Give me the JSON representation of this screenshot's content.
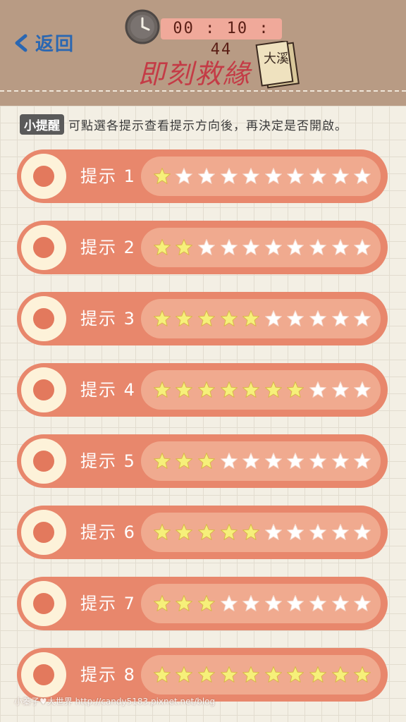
{
  "header": {
    "back_label": "返回",
    "timer": "00 : 10 : 44",
    "logo_text": "即刻救緣",
    "ticket_text": "大溪"
  },
  "reminder": {
    "tag": "小提醒",
    "text": "可點選各提示查看提示方向後，再決定是否開啟。"
  },
  "hints": [
    {
      "label": "提示 1",
      "stars": 1
    },
    {
      "label": "提示 2",
      "stars": 2
    },
    {
      "label": "提示 3",
      "stars": 5
    },
    {
      "label": "提示 4",
      "stars": 7
    },
    {
      "label": "提示 5",
      "stars": 3
    },
    {
      "label": "提示 6",
      "stars": 5
    },
    {
      "label": "提示 7",
      "stars": 3
    },
    {
      "label": "提示 8",
      "stars": 10
    }
  ],
  "max_stars": 10,
  "watermark": "小蓁子♥大世界 http://candy5183.pixnet.net/blog",
  "colors": {
    "header_bg": "#b89b84",
    "row_bg": "#e8876c",
    "star_track": "#f0aa8f",
    "star_filled": "#f6f07a",
    "star_empty": "#ffffff",
    "back_blue": "#2a67b2"
  }
}
